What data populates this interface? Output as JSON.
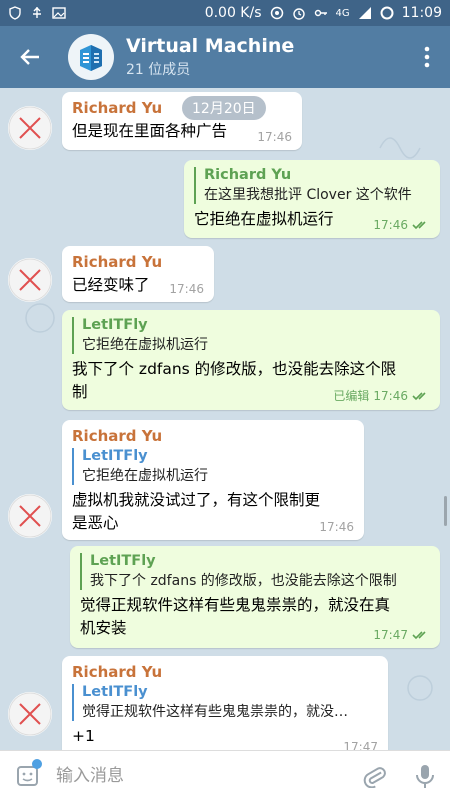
{
  "status_bar": {
    "speed": "0.00 K/s",
    "signal_label": "4G",
    "time": "11:09"
  },
  "header": {
    "title": "Virtual Machine",
    "subtitle": "21 位成员"
  },
  "chat": {
    "date_badge": "12月20日",
    "messages": [
      {
        "sender": "Richard Yu",
        "text": "但是现在里面各种广告",
        "time": "17:46"
      },
      {
        "reply_name": "Richard Yu",
        "reply_text": "在这里我想批评 Clover 这个软件",
        "text": "它拒绝在虚拟机运行",
        "time": "17:46"
      },
      {
        "sender": "Richard Yu",
        "text": "已经变味了",
        "time": "17:46"
      },
      {
        "reply_name": "LetITFly",
        "reply_text": "它拒绝在虚拟机运行",
        "text_line1": "我下了个 zdfans 的修改版，也没能去除这个限",
        "text_line2": "制",
        "edited": "已编辑",
        "time": "17:46"
      },
      {
        "sender": "Richard Yu",
        "reply_name": "LetITFly",
        "reply_text": "它拒绝在虚拟机运行",
        "text_line1": "虚拟机我就没试过了，有这个限制更",
        "text_line2": "是恶心",
        "time": "17:46"
      },
      {
        "reply_name": "LetITFly",
        "reply_text": "我下了个 zdfans 的修改版，也没能去除这个限制",
        "text_line1": "觉得正规软件这样有些鬼鬼祟祟的，就没在真",
        "text_line2": "机安装",
        "time": "17:47"
      },
      {
        "sender": "Richard Yu",
        "reply_name": "LetITFly",
        "reply_text": "觉得正规软件这样有些鬼鬼祟祟的，就没…",
        "text": "+1",
        "time": "17:47"
      }
    ]
  },
  "input": {
    "placeholder": "输入消息"
  },
  "colors": {
    "header": "#527da3",
    "status_bar": "#3f6488",
    "outgoing_bubble": "#effdde",
    "sender_name": "#c8733a",
    "reply_outgoing": "#5ea253",
    "reply_incoming": "#4a90d0"
  },
  "icons": [
    "back-arrow-icon",
    "group-avatar-icon",
    "more-vert-icon",
    "avatar-placeholder-icon",
    "double-check-icon",
    "emoji-icon",
    "attach-icon",
    "mic-icon"
  ]
}
